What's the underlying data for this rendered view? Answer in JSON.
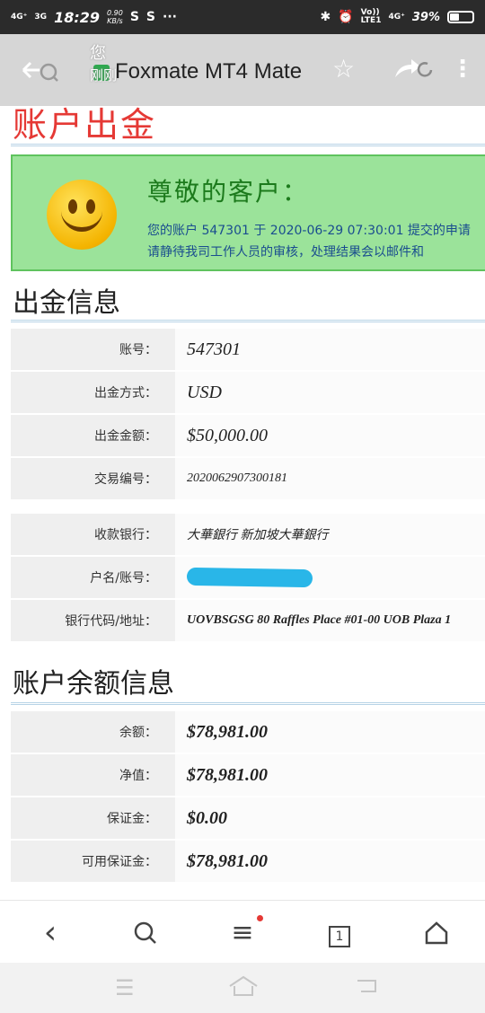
{
  "status_bar": {
    "sim1": "4G⁺",
    "sim2": "3G",
    "time": "18:29",
    "speed_value": "0.90",
    "speed_unit": "KB/s",
    "app_icon_1": "S",
    "app_icon_2": "S",
    "dots": "···",
    "volte": "Vo))\nLTE1",
    "sim3": "4G⁺",
    "battery_pct": "39%",
    "battery_level": 0.39
  },
  "browser": {
    "title": "Foxmate MT4 Mate",
    "notif_char": "您",
    "notif_time": "刚刚"
  },
  "page": {
    "heading": "账户出金",
    "notice": {
      "title": "尊敬的客户：",
      "line1": "您的账户 547301 于 2020-06-29 07:30:01 提交的申请",
      "line2": "请静待我司工作人员的审核，处理结果会以邮件和"
    },
    "withdrawal_section_title": "出金信息",
    "withdrawal_rows": [
      {
        "label": "账号：",
        "value": "547301"
      },
      {
        "label": "出金方式：",
        "value": "USD"
      },
      {
        "label": "出金金额：",
        "value": "$50,000.00"
      },
      {
        "label": "交易编号：",
        "value": "2020062907300181"
      }
    ],
    "bank_rows": [
      {
        "label": "收款银行：",
        "value": "大華銀行 新加坡大華銀行"
      },
      {
        "label": "户名/账号：",
        "value": ""
      },
      {
        "label": "银行代码/地址：",
        "value": "UOVBSGSG 80 Raffles Place #01-00 UOB Plaza 1"
      }
    ],
    "balance_section_title": "账户余额信息",
    "balance_rows": [
      {
        "label": "余额：",
        "value": "$78,981.00"
      },
      {
        "label": "净值：",
        "value": "$78,981.00"
      },
      {
        "label": "保证金：",
        "value": "$0.00"
      },
      {
        "label": "可用保证金：",
        "value": "$78,981.00"
      }
    ]
  },
  "bottom_nav": {
    "back": "‹",
    "search": "○",
    "menu": "≡",
    "tabs_count": "1",
    "home": "⌂"
  },
  "colors": {
    "red": "#e53935",
    "green": "#2aa52a",
    "blue": "#1e88e5",
    "notice_bg": "#9be39a"
  }
}
